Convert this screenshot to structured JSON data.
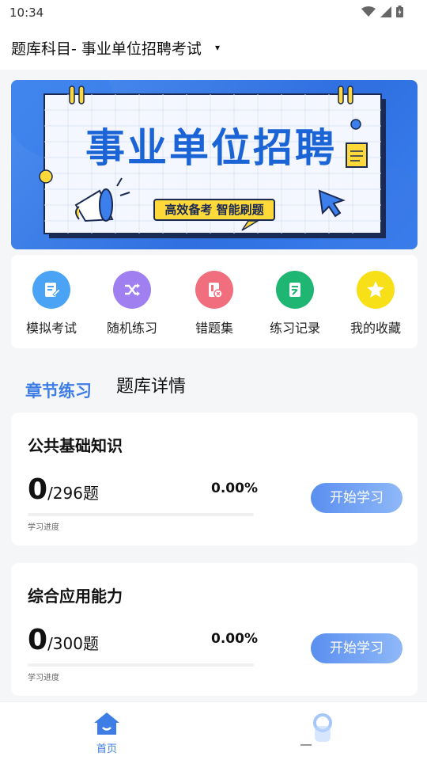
{
  "status_bar": {
    "time": "10:34"
  },
  "header": {
    "subject_title": "题库科目- 事业单位招聘考试",
    "caret": "▾"
  },
  "banner": {
    "title": "事业单位招聘",
    "subtitle": "高效备考 智能刷题"
  },
  "quick_actions": [
    {
      "label": "模拟考试",
      "icon": "exam-icon",
      "color": "#4aa3f5"
    },
    {
      "label": "随机练习",
      "icon": "shuffle-icon",
      "color": "#a07ff0"
    },
    {
      "label": "错题集",
      "icon": "wrong-questions-icon",
      "color": "#f06e7e"
    },
    {
      "label": "练习记录",
      "icon": "record-icon",
      "color": "#1fb573"
    },
    {
      "label": "我的收藏",
      "icon": "star-icon",
      "color": "#f7e017"
    }
  ],
  "tabs": {
    "chapter": "章节练习",
    "detail": "题库详情"
  },
  "subjects": [
    {
      "title": "公共基础知识",
      "done": "0",
      "total": "/296题",
      "progress": 0.0,
      "percent": "0.00%",
      "caption": "学习进度",
      "button": "开始学习"
    },
    {
      "title": "综合应用能力",
      "done": "0",
      "total": "/300题",
      "progress": 0.0,
      "percent": "0.00%",
      "caption": "学习进度",
      "button": "开始学习"
    }
  ],
  "bottom_nav": {
    "home_label": "首页"
  },
  "colors": {
    "accent": "#3f7de6",
    "banner_yellow": "#ffd93a"
  }
}
